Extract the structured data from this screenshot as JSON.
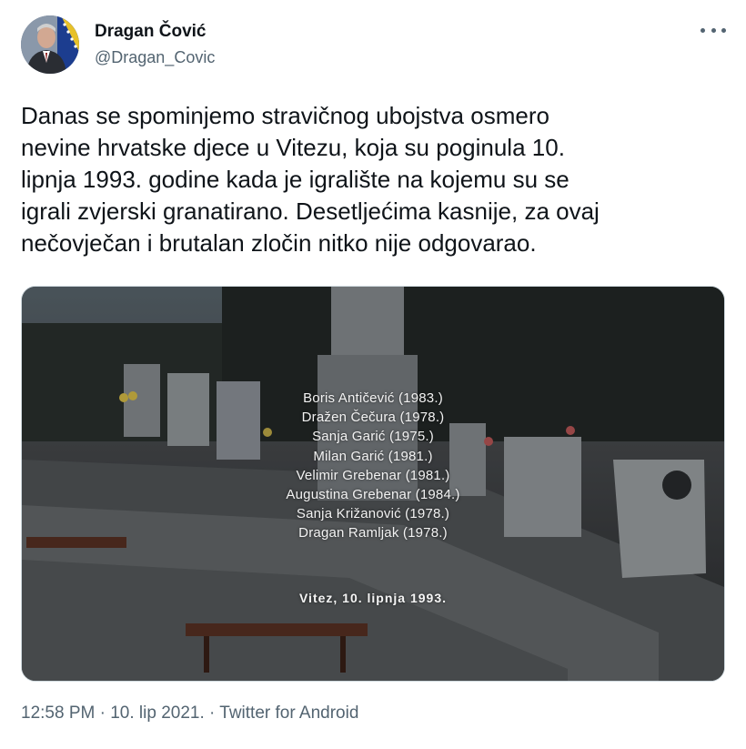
{
  "author": {
    "name": "Dragan Čović",
    "handle": "@Dragan_Covic",
    "avatar_icon": "profile-photo"
  },
  "menu_icon": "more-horizontal-icon",
  "tweet": {
    "text": "Danas se spominjemo stravičnog ubojstva osmero\nnevine hrvatske djece u Vitezu, koja su poginula 10.\nlipnja 1993. godine kada je igralište na kojemu su se\nigrali zvjerski granatirano. Desetljećima kasnije, za ovaj\nnečovječan i brutalan zločin nitko nije odgovarao."
  },
  "photo": {
    "victims": [
      "Boris Antičević (1983.)",
      "Dražen Čečura (1978.)",
      "Sanja Garić (1975.)",
      "Milan Garić (1981.)",
      "Velimir Grebenar (1981.)",
      "Augustina Grebenar (1984.)",
      "Sanja Križanović (1978.)",
      "Dragan Ramljak (1978.)"
    ],
    "caption": "Vitez, 10. lipnja 1993."
  },
  "meta": {
    "timestamp": "12:58 PM · 10. lip 2021. · Twitter for Android"
  }
}
